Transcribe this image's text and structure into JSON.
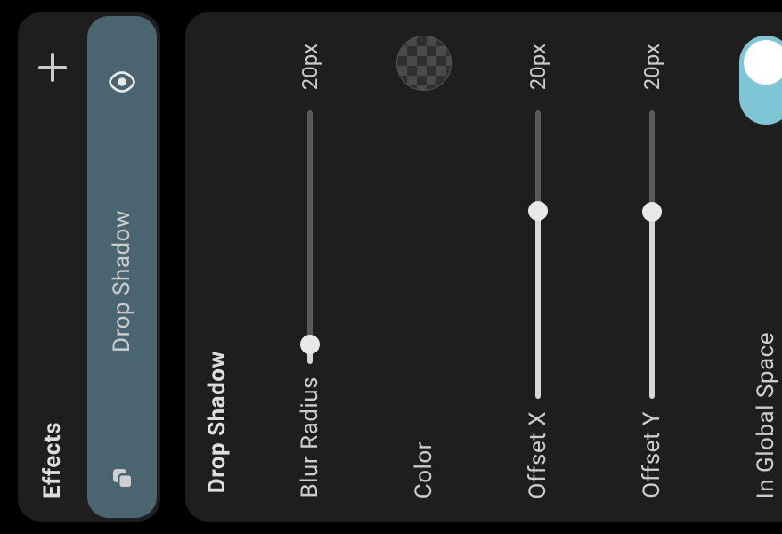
{
  "sidebar": {
    "title": "Effects",
    "item": {
      "label": "Drop Shadow"
    }
  },
  "panel": {
    "title": "Drop Shadow",
    "blur": {
      "label": "Blur Radius",
      "value": "20px",
      "percent": 8
    },
    "offsetx": {
      "label": "Offset X",
      "value": "20px",
      "percent": 65
    },
    "offsety": {
      "label": "Offset Y",
      "value": "20px",
      "percent": 65
    },
    "color": {
      "label": "Color"
    },
    "global": {
      "label": "In Global Space",
      "on": true
    }
  }
}
